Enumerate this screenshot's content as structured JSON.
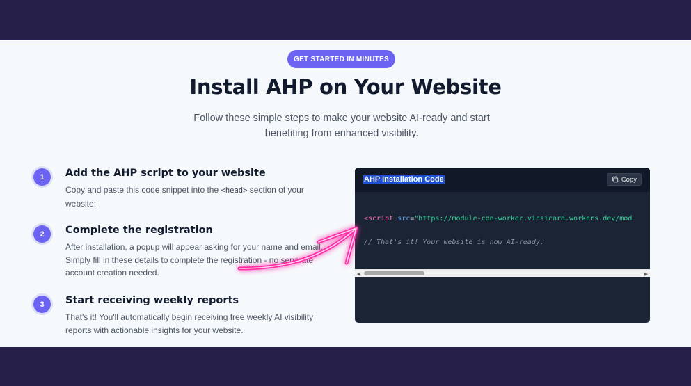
{
  "hero": {
    "badge": "GET STARTED IN MINUTES",
    "title": "Install AHP on Your Website",
    "subtitle": "Follow these simple steps to make your website AI-ready and start benefiting from enhanced visibility."
  },
  "steps": [
    {
      "number": "1",
      "title": "Add the AHP script to your website",
      "body_before": "Copy and paste this code snippet into the",
      "body_code": "<head>",
      "body_after": "section of your website:"
    },
    {
      "number": "2",
      "title": "Complete the registration",
      "body": "After installation, a popup will appear asking for your name and email. Simply fill in these details to complete the registration - no separate account creation needed."
    },
    {
      "number": "3",
      "title": "Start receiving weekly reports",
      "body": "That's it! You'll automatically begin receiving free weekly AI visibility reports with actionable insights for your website."
    }
  ],
  "code_card": {
    "title": "AHP Installation Code",
    "copy_label": "Copy",
    "line1": {
      "tag": "<script",
      "attr": "src",
      "eq": "=",
      "value": "\"https://module-cdn-worker.vicsicard.workers.dev/mod"
    },
    "line2": "// That's it! Your website is now AI-ready."
  },
  "colors": {
    "accent": "#6c63f2",
    "dark_band": "#261f49",
    "code_bg": "#1b2434",
    "arrow": "#ff2fa8"
  }
}
